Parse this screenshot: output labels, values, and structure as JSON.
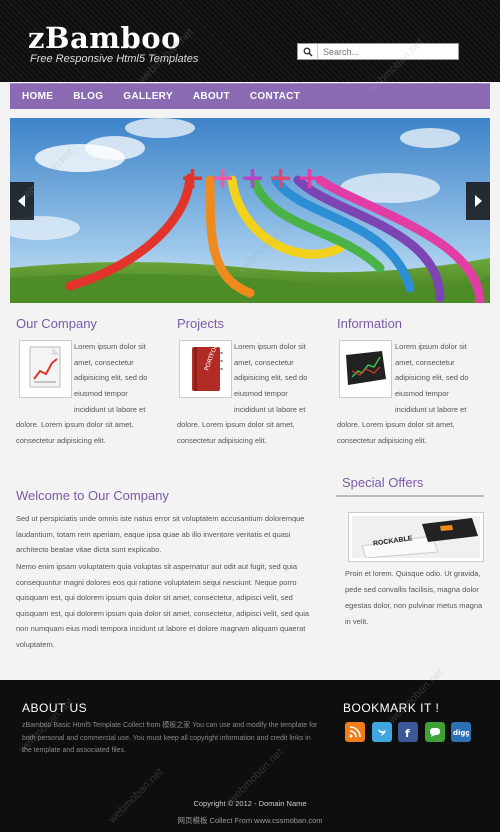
{
  "header": {
    "logo": "zBamboo",
    "tagline": "Free Responsive Html5 Templates",
    "search_placeholder": "Search..."
  },
  "nav": {
    "items": [
      "HOME",
      "BLOG",
      "GALLERY",
      "ABOUT",
      "CONTACT"
    ]
  },
  "columns": [
    {
      "title": "Our Company",
      "icon": "chart-document-icon",
      "side_text": "Lorem ipsum dolor sit amet, consectetur adipisicing elit, sed do eiusmod tempor incididunt ut labore et",
      "bottom_text": "dolore. Lorem ipsum dolor sit amet, consectetur adipisicing elit."
    },
    {
      "title": "Projects",
      "icon": "portfolio-book-icon",
      "side_text": "Lorem ipsum dolor sit amet, consectetur adipisicing elit, sed do eiusmod tempor incididunt ut labore et",
      "bottom_text": "dolore. Lorem ipsum dolor sit amet, consectetur adipisicing elit."
    },
    {
      "title": "Information",
      "icon": "monitor-chart-icon",
      "side_text": "Lorem ipsum dolor sit amet, consectetur adipisicing elit, sed do eiusmod tempor incididunt ut labore et",
      "bottom_text": "dolore. Lorem ipsum dolor sit amet, consectetur adipisicing elit."
    }
  ],
  "welcome": {
    "title": "Welcome to Our Company",
    "para1": "Sed ut perspiciatis unde omnis iste natus error sit voluptatem accusantium doloremque laudantium, totam rem aperiam, eaque ipsa quae ab illo inventore veritatis et quasi architecto beatae vitae dicta sunt explicabo.",
    "para2": "Nemo enim ipsam voluptatem quia voluptas sit aspernatur aut odit aut fugit, sed quia consequuntur magni dolores eos qui ratione voluptatem sequi nesciunt. Neque porro quisquam est, qui dolorem ipsum quia dolor sit amet, consectetur, adipisci velit, sed quisquam est, qui dolorem ipsum quia dolor sit amet, consectetur, adipisci velit, sed quia non numquam eius modi tempora incidunt ut labore et dolore magnam aliquam quaerat voluptatem."
  },
  "offers": {
    "title": "Special Offers",
    "image_text": "ROCKABLE",
    "text": "Proin et lorem. Quisque odio. Ut gravida, pede sed convallis facilisis, magna dolor egestas dolor, non pulvinar metus magna in velit."
  },
  "footer": {
    "about_title": "ABOUT US",
    "about_text": "zBamboo Basic Html5 Template Collect from 模板之家 You can use and modify the template for both personal and commercial use. You must keep all copyright information and credit links in the template and associated files.",
    "bookmark_title": "BOOKMARK IT !",
    "social": [
      "rss",
      "twitter",
      "facebook",
      "share",
      "digg"
    ],
    "copyright": "Copyright © 2012 - Domain Name",
    "collect": "网页模板 Collect From www.cssmoban.com"
  },
  "watermark": "webmoban.net",
  "colors": {
    "accent": "#8a6ab3",
    "heading": "#7a5aa6",
    "header_bg": "#111111",
    "footer_bg": "#0e0e0e"
  }
}
